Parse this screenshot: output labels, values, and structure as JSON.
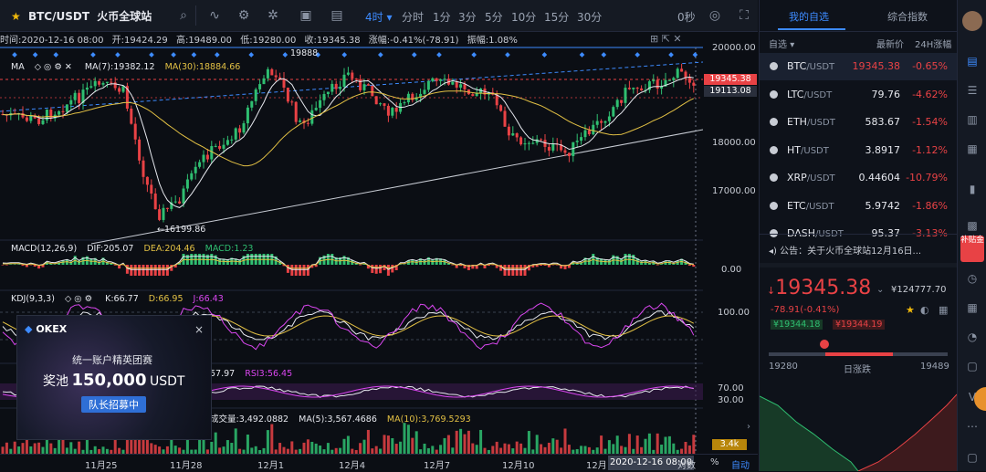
{
  "toolbar": {
    "pair": "BTC/USDT",
    "exchange": "火币全球站",
    "timeframes": [
      "4时",
      "分时",
      "1分",
      "3分",
      "5分",
      "10分",
      "15分",
      "30分"
    ],
    "active_timeframe": "4时",
    "countdown": "0秒"
  },
  "infobar": {
    "time": "时间:2020-12-16 08:00",
    "open": "开:19424.29",
    "high": "高:19489.00",
    "low": "低:19280.00",
    "close": "收:19345.38",
    "change": "涨幅:-0.41%(-78.91)",
    "amplitude": "振幅:1.08%"
  },
  "ma_legend": {
    "name": "MA",
    "ma7": "MA(7):19382.12",
    "ma30": "MA(30):18884.66"
  },
  "annotations": {
    "high_mark": "19888",
    "low_mark": "←16199.86"
  },
  "price_axis": {
    "labels": [
      "20000.00",
      "18000.00",
      "17000.00"
    ],
    "current_price": "19345.38",
    "secondary_price": "19113.08"
  },
  "macd": {
    "name": "MACD(12,26,9)",
    "dif": "DIF:205.07",
    "dea": "DEA:204.46",
    "macd": "MACD:1.23",
    "axis_label": "0.00"
  },
  "kdj": {
    "name": "KDJ(9,3,3)",
    "k": "K:66.77",
    "d": "D:66.95",
    "j": "J:66.43",
    "axis_label": "100.00"
  },
  "rsi": {
    "rsi_a": "57.97",
    "rsi_b": "RSI3:56.45",
    "axis_labels": [
      "70.00",
      "30.00"
    ]
  },
  "volume": {
    "label": "成交量:3,492.0882",
    "ma5": "MA(5):3,567.4686",
    "ma10": "MA(10):3,769.5293",
    "axis_label": "3.4k"
  },
  "x_axis": {
    "labels": [
      "11月25",
      "11月28",
      "12月1",
      "12月4",
      "12月7",
      "12月10",
      "12月"
    ],
    "cursor_time": "2020-12-16 08:00",
    "log_toggle": "对数",
    "percent_toggle": "%",
    "auto_toggle": "自动"
  },
  "ad": {
    "brand": "OKEX",
    "headline": "统一账户精英团赛",
    "prize_prefix": "奖池",
    "prize_amount": "150,000",
    "prize_unit": "USDT",
    "cta": "队长招募中",
    "close": "×"
  },
  "right_panel": {
    "tabs": [
      "我的自选",
      "综合指数"
    ],
    "active_tab": "我的自选",
    "list_header": {
      "filter": "自选",
      "price": "最新价",
      "change": "24H涨幅"
    },
    "watchlist": [
      {
        "base": "BTC",
        "quote": "/USDT",
        "price": "19345.38",
        "change": "-0.65%",
        "selected": true
      },
      {
        "base": "LTC",
        "quote": "/USDT",
        "price": "79.76",
        "change": "-4.62%"
      },
      {
        "base": "ETH",
        "quote": "/USDT",
        "price": "583.67",
        "change": "-1.54%"
      },
      {
        "base": "HT",
        "quote": "/USDT",
        "price": "3.8917",
        "change": "-1.12%"
      },
      {
        "base": "XRP",
        "quote": "/USDT",
        "price": "0.44604",
        "change": "-10.79%"
      },
      {
        "base": "ETC",
        "quote": "/USDT",
        "price": "5.9742",
        "change": "-1.86%"
      },
      {
        "base": "DASH",
        "quote": "/USDT",
        "price": "95.37",
        "change": "-3.13%"
      }
    ],
    "notice": "公告：关于火币全球站12月16日...",
    "ticker": {
      "price": "19345.38",
      "cny": "¥124777.70",
      "change": "-78.91(-0.41%)",
      "bid": "¥19344.18",
      "ask": "¥19344.19",
      "low": "19280",
      "low_label": "日涨跌",
      "high": "19489"
    }
  },
  "rail": {
    "badge": "补贴金"
  },
  "colors": {
    "up": "#2fbf71",
    "down": "#e84245",
    "accent": "#3d8bff",
    "ma7": "#e6e8ee",
    "ma30": "#e2c044",
    "background": "#0b0e14"
  }
}
